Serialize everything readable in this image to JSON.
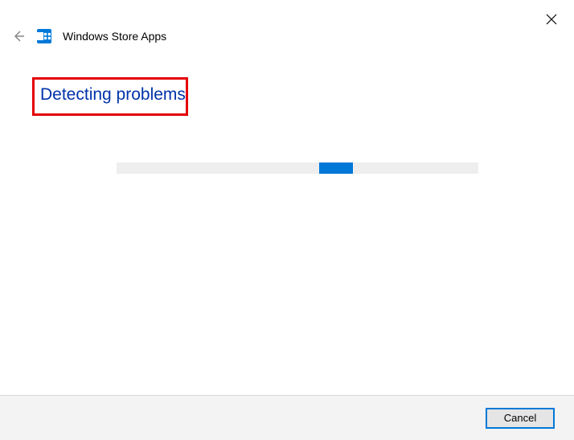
{
  "window": {
    "title": "Windows Store Apps"
  },
  "status": {
    "heading": "Detecting problems"
  },
  "footer": {
    "cancel_label": "Cancel"
  },
  "colors": {
    "accent": "#0078d7",
    "heading": "#0033aa",
    "highlight_border": "#e40000"
  }
}
